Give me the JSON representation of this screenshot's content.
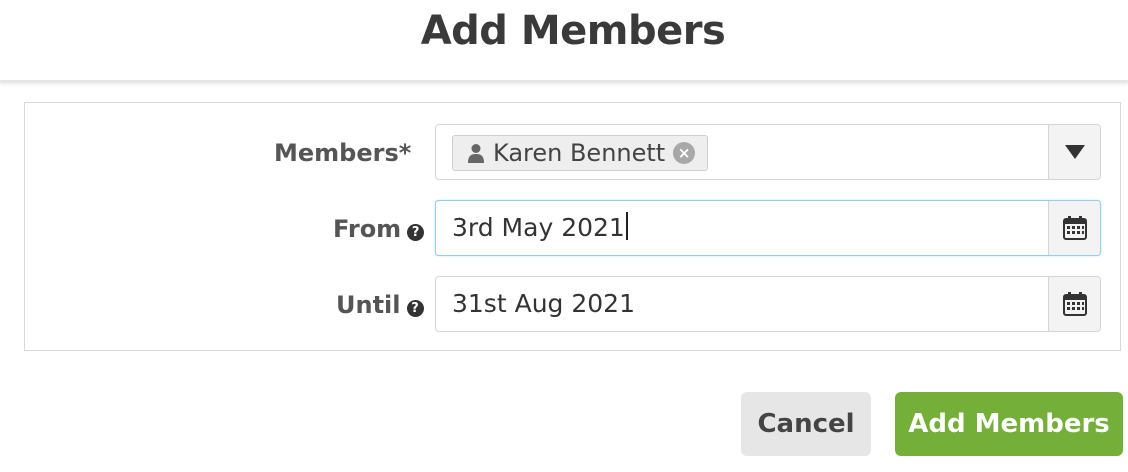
{
  "modal": {
    "title": "Add Members"
  },
  "form": {
    "members": {
      "label": "Members*",
      "selected_tags": [
        {
          "name": "Karen Bennett",
          "icon": "user-icon"
        }
      ],
      "dropdown_icon": "caret-down-icon"
    },
    "from": {
      "label": "From",
      "help_icon": "question-circle-icon",
      "value": "3rd May 2021",
      "focused": true,
      "calendar_icon": "calendar-icon"
    },
    "until": {
      "label": "Until",
      "help_icon": "question-circle-icon",
      "value": "31st Aug 2021",
      "calendar_icon": "calendar-icon"
    }
  },
  "buttons": {
    "cancel_label": "Cancel",
    "add_label": "Add Members"
  },
  "colors": {
    "primary_button": "#74af3a",
    "secondary_button": "#e6e6e6",
    "focus_border": "#8fd0ea"
  }
}
